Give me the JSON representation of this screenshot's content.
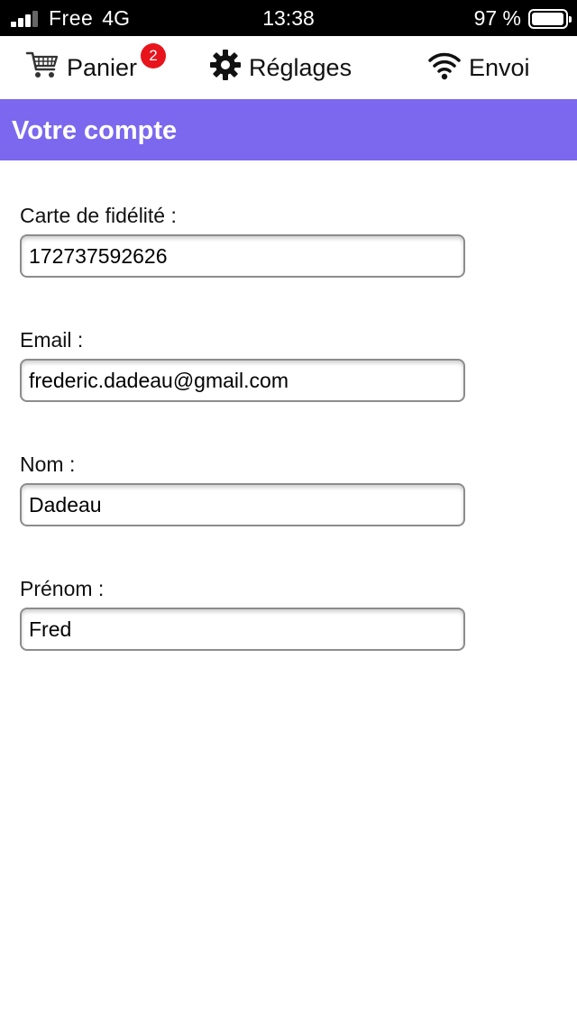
{
  "status_bar": {
    "carrier": "Free",
    "network": "4G",
    "time": "13:38",
    "battery": "97 %",
    "battery_level": 0.97,
    "signal_bars": 3
  },
  "nav": {
    "cart_label": "Panier",
    "cart_badge": "2",
    "settings_label": "Réglages",
    "send_label": "Envoi"
  },
  "header": {
    "title": "Votre compte"
  },
  "form": {
    "fields": [
      {
        "label": "Carte de fidélité :",
        "value": "172737592626"
      },
      {
        "label": "Email :",
        "value": "frederic.dadeau@gmail.com"
      },
      {
        "label": "Nom :",
        "value": "Dadeau"
      },
      {
        "label": "Prénom :",
        "value": "Fred"
      }
    ]
  },
  "colors": {
    "header_bg": "#7b68ee",
    "badge_bg": "#e8141c"
  }
}
